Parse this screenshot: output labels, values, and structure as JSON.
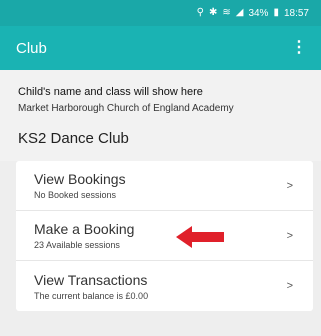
{
  "status_bar": {
    "location_icon": "location-pin-icon",
    "bluetooth_icon": "bluetooth-icon",
    "wifi_icon": "wifi-icon",
    "signal_icon": "signal-icon",
    "battery_percent": "34%",
    "battery_icon": "battery-icon",
    "time": "18:57"
  },
  "app_bar": {
    "title": "Club",
    "overflow_icon": "overflow-menu-icon",
    "overflow_glyph": "⋮"
  },
  "info": {
    "child_line": "Child's name and class will show here",
    "school": "Market Harborough Church of England Academy",
    "club_name": "KS2 Dance Club"
  },
  "menu": {
    "items": [
      {
        "title": "View Bookings",
        "subtitle": "No Booked sessions",
        "chevron": ">"
      },
      {
        "title": "Make a Booking",
        "subtitle": "23 Available sessions",
        "chevron": ">"
      },
      {
        "title": "View Transactions",
        "subtitle": "The current balance is £0.00",
        "chevron": ">"
      }
    ]
  },
  "colors": {
    "status_bar": "#1aa8a8",
    "app_bar": "#1ab3b3",
    "annotation_arrow": "#e0202a"
  }
}
